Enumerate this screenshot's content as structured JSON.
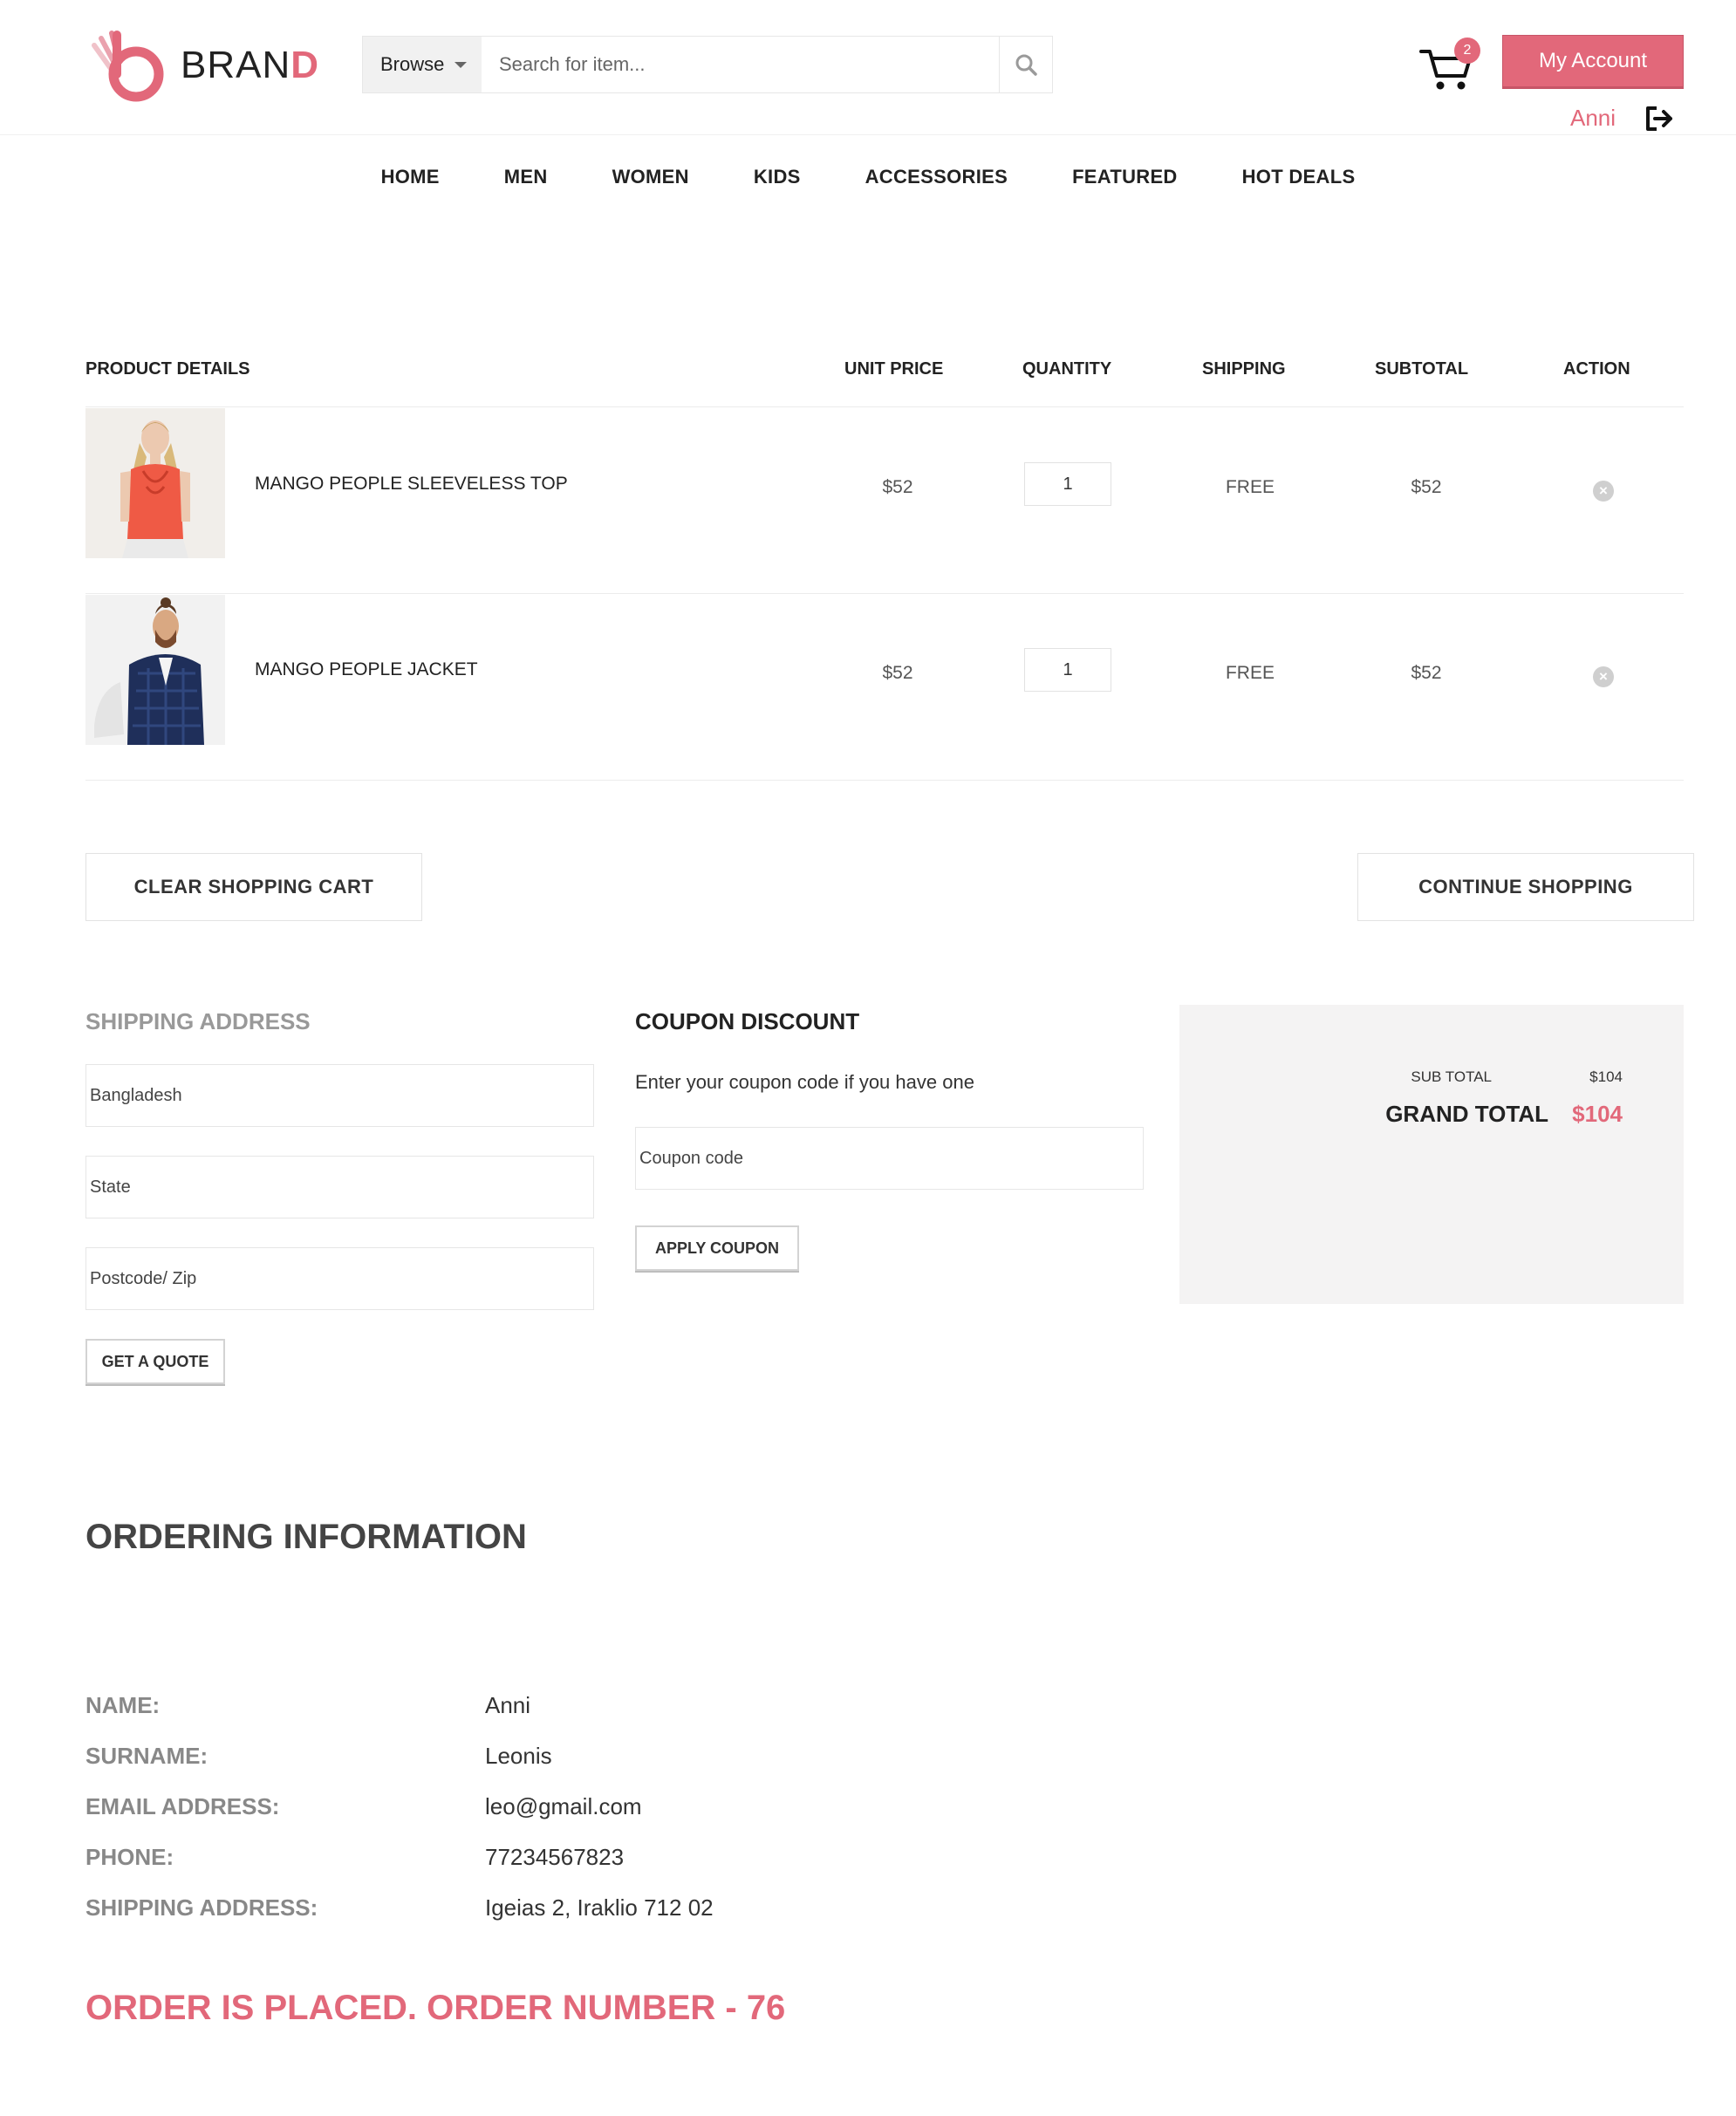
{
  "brand": {
    "name_main": "BRAN",
    "name_accent": "D"
  },
  "search": {
    "browse_label": "Browse",
    "placeholder": "Search for item..."
  },
  "cart": {
    "count": "2"
  },
  "account": {
    "button_label": "My Account",
    "user_name": "Anni"
  },
  "nav": {
    "items": [
      "HOME",
      "MEN",
      "WOMEN",
      "KIDS",
      "ACCESSORIES",
      "FEATURED",
      "HOT DEALS"
    ]
  },
  "table": {
    "headers": {
      "product": "PRODUCT DETAILS",
      "unit_price": "UNIT PRICE",
      "quantity": "QUANTITY",
      "shipping": "SHIPPING",
      "subtotal": "SUBTOTAL",
      "action": "ACTION"
    },
    "rows": [
      {
        "name": "MANGO PEOPLE SLEEVELESS TOP",
        "unit_price": "$52",
        "quantity": "1",
        "shipping": "FREE",
        "subtotal": "$52"
      },
      {
        "name": "MANGO PEOPLE JACKET",
        "unit_price": "$52",
        "quantity": "1",
        "shipping": "FREE",
        "subtotal": "$52"
      }
    ]
  },
  "cart_actions": {
    "clear": "CLEAR SHOPPING CART",
    "continue": "CONTINUE SHOPPING"
  },
  "shipping_form": {
    "title": "SHIPPING ADDRESS",
    "country_value": "Bangladesh",
    "state_placeholder": "State",
    "zip_placeholder": "Postcode/ Zip",
    "quote_button": "GET A QUOTE"
  },
  "coupon": {
    "title": "COUPON DISCOUNT",
    "hint": "Enter your coupon code if you have one",
    "placeholder": "Coupon code",
    "button": "APPLY COUPON"
  },
  "totals": {
    "sub_label": "SUB TOTAL",
    "sub_value": "$104",
    "grand_label": "GRAND TOTAL",
    "grand_value": "$104"
  },
  "ordering": {
    "title": "ORDERING INFORMATION",
    "fields": [
      {
        "label": "NAME:",
        "value": "Anni"
      },
      {
        "label": "SURNAME:",
        "value": "Leonis"
      },
      {
        "label": "EMAIL ADDRESS:",
        "value": "leo@gmail.com"
      },
      {
        "label": "PHONE:",
        "value": "77234567823"
      },
      {
        "label": "SHIPPING ADDRESS:",
        "value": "Igeias 2, Iraklio 712 02"
      }
    ],
    "confirmation": "ORDER IS PLACED. ORDER NUMBER - 76"
  },
  "colors": {
    "accent": "#e2687a",
    "panel": "#f4f3f3",
    "text": "#222222"
  }
}
